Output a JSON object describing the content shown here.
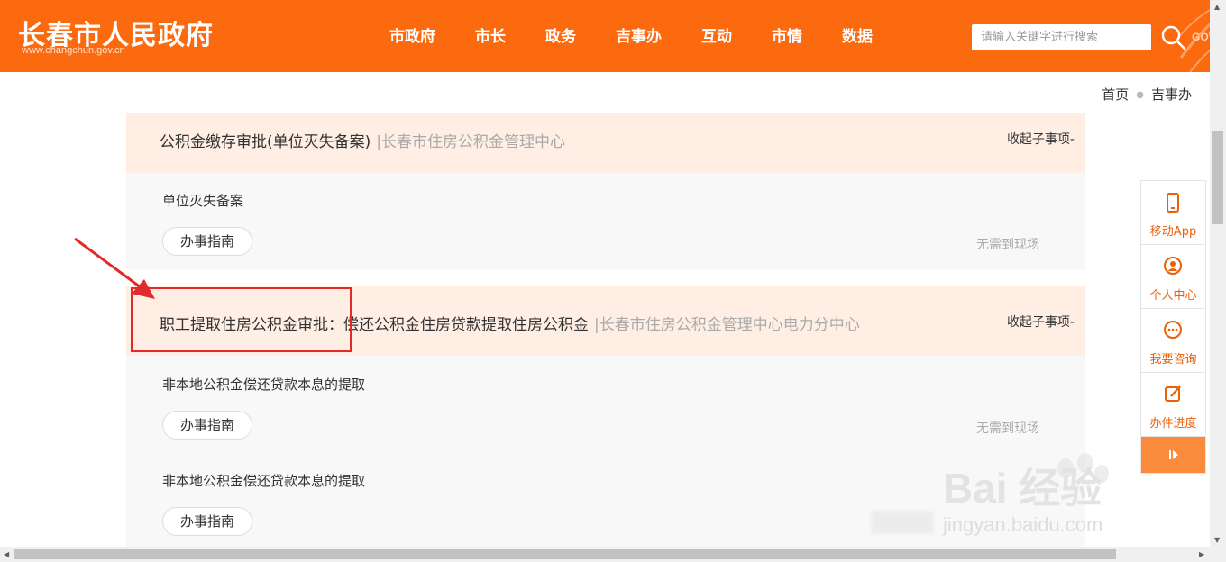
{
  "header": {
    "site_title": "长春市人民政府",
    "site_url": "www.changchun.gov.cn",
    "nav": [
      "市政府",
      "市长",
      "政务",
      "吉事办",
      "互动",
      "市情",
      "数据"
    ],
    "search_placeholder": "请输入关键字进行搜索",
    "gov_mark": "GOV"
  },
  "breadcrumb": {
    "home": "首页",
    "current": "吉事办"
  },
  "categories": [
    {
      "title": "公积金缴存审批(单位灭失备案)",
      "dept": "|长春市住房公积金管理中心",
      "collapse": "收起子事项-",
      "items": [
        {
          "title": "单位灭失备案",
          "button": "办事指南",
          "tag": "无需到现场"
        }
      ]
    },
    {
      "title": "职工提取住房公积金审批：偿还公积金住房贷款提取住房公积金",
      "dept": "|长春市住房公积金管理中心电力分中心",
      "collapse": "收起子事项-",
      "items": [
        {
          "title": "非本地公积金偿还贷款本息的提取",
          "button": "办事指南",
          "tag": "无需到现场"
        },
        {
          "title": "非本地公积金偿还贷款本息的提取",
          "button": "办事指南",
          "tag": ""
        }
      ]
    }
  ],
  "sidebar": {
    "items": [
      {
        "label": "移动App",
        "icon": "phone-icon"
      },
      {
        "label": "个人中心",
        "icon": "user-icon"
      },
      {
        "label": "我要咨询",
        "icon": "chat-icon"
      },
      {
        "label": "办件进度",
        "icon": "edit-icon"
      }
    ]
  },
  "watermark": {
    "brand": "Bai 经验",
    "url": "jingyan.baidu.com"
  },
  "colors": {
    "brand_orange": "#fc6a0f",
    "category_bg": "#feeee4",
    "annotation_red": "#e12b2b"
  }
}
